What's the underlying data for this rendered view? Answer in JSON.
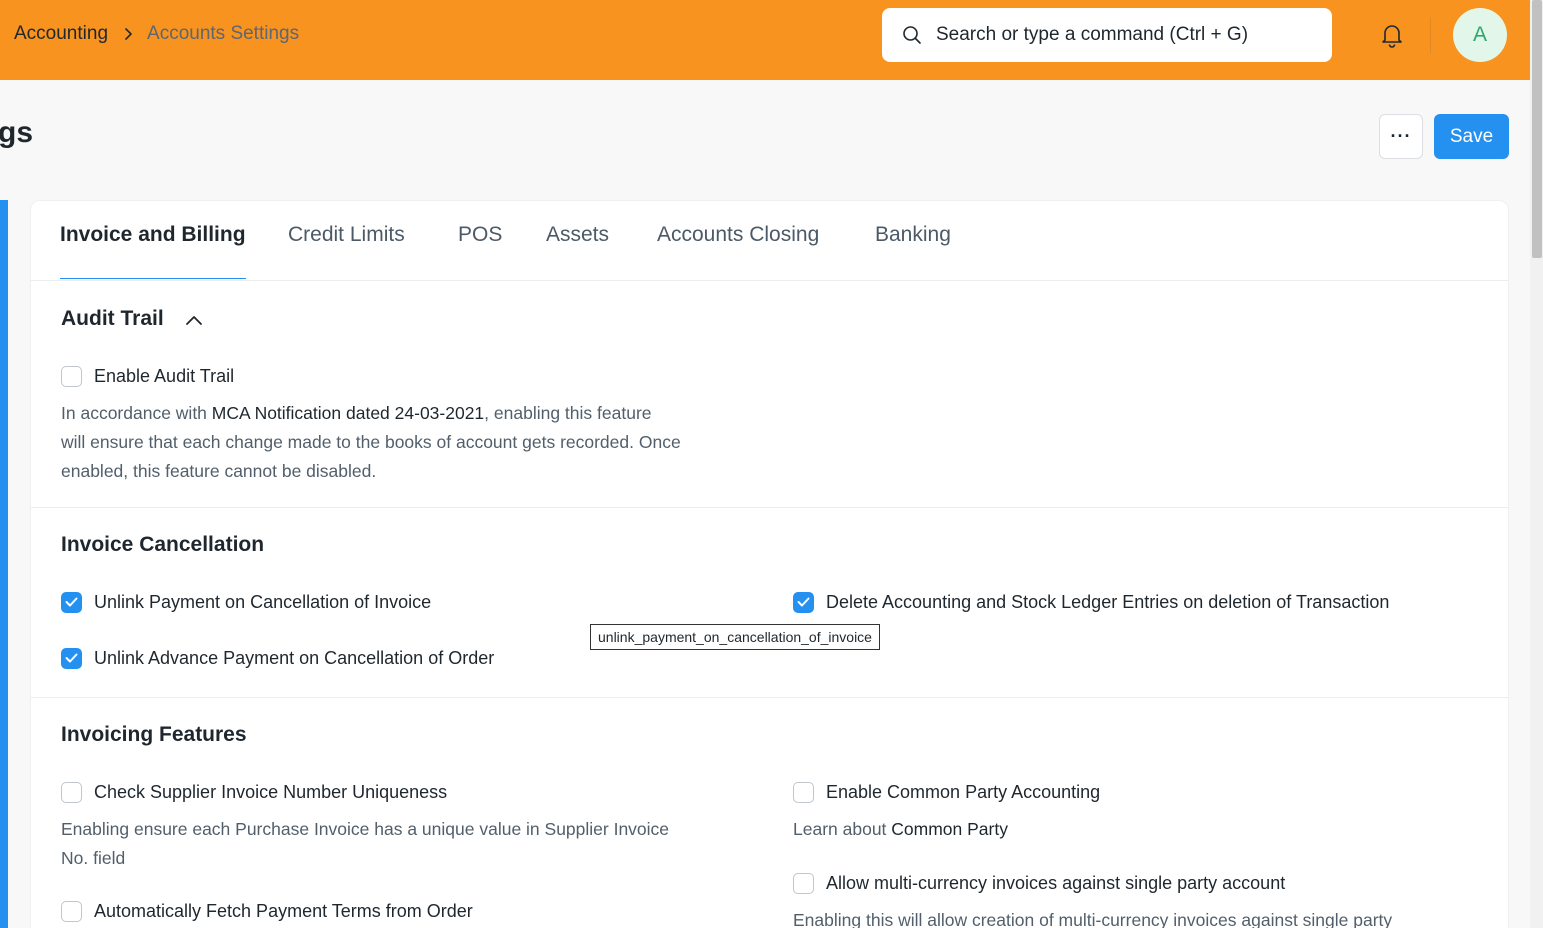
{
  "breadcrumb": {
    "root": "Accounting",
    "current": "Accounts Settings"
  },
  "search": {
    "placeholder": "Search or type a command (Ctrl + G)"
  },
  "user": {
    "avatar_initial": "A"
  },
  "page": {
    "title": "gs",
    "more_label": "···",
    "save_label": "Save"
  },
  "tabs": [
    {
      "label": "Invoice and Billing",
      "active": true
    },
    {
      "label": "Credit Limits"
    },
    {
      "label": "POS"
    },
    {
      "label": "Assets"
    },
    {
      "label": "Accounts Closing"
    },
    {
      "label": "Banking"
    }
  ],
  "audit_trail": {
    "title": "Audit Trail",
    "enable_label": "Enable Audit Trail",
    "enable_checked": false,
    "desc_prefix": "In accordance with ",
    "desc_link": "MCA Notification dated 24-03-2021",
    "desc_suffix_1": ", enabling this feature",
    "desc_line2": "will ensure that each change made to the books of account gets recorded. Once",
    "desc_line3": "enabled, this feature cannot be disabled."
  },
  "invoice_cancellation": {
    "title": "Invoice Cancellation",
    "unlink_payment_label": "Unlink Payment on Cancellation of Invoice",
    "unlink_payment_checked": true,
    "unlink_advance_label": "Unlink Advance Payment on Cancellation of Order",
    "unlink_advance_checked": true,
    "delete_entries_label": "Delete Accounting and Stock Ledger Entries on deletion of Transaction",
    "delete_entries_checked": true
  },
  "tooltip": {
    "text": "unlink_payment_on_cancellation_of_invoice"
  },
  "invoicing_features": {
    "title": "Invoicing Features",
    "supplier_uniqueness_label": "Check Supplier Invoice Number Uniqueness",
    "supplier_uniqueness_checked": false,
    "supplier_desc_line1": "Enabling ensure each Purchase Invoice has a unique value in Supplier Invoice",
    "supplier_desc_line2": "No. field",
    "fetch_terms_label": "Automatically Fetch Payment Terms from Order",
    "fetch_terms_checked": false,
    "common_party_label": "Enable Common Party Accounting",
    "common_party_checked": false,
    "common_party_desc_prefix": "Learn about ",
    "common_party_desc_link": "Common Party",
    "multi_currency_label": "Allow multi-currency invoices against single party account",
    "multi_currency_checked": false,
    "multi_currency_desc": "Enabling this will allow creation of multi-currency invoices against single party"
  },
  "colors": {
    "navbar": "#f7931e",
    "primary": "#2490ef",
    "text": "#1f272e",
    "muted": "#525f6b"
  }
}
